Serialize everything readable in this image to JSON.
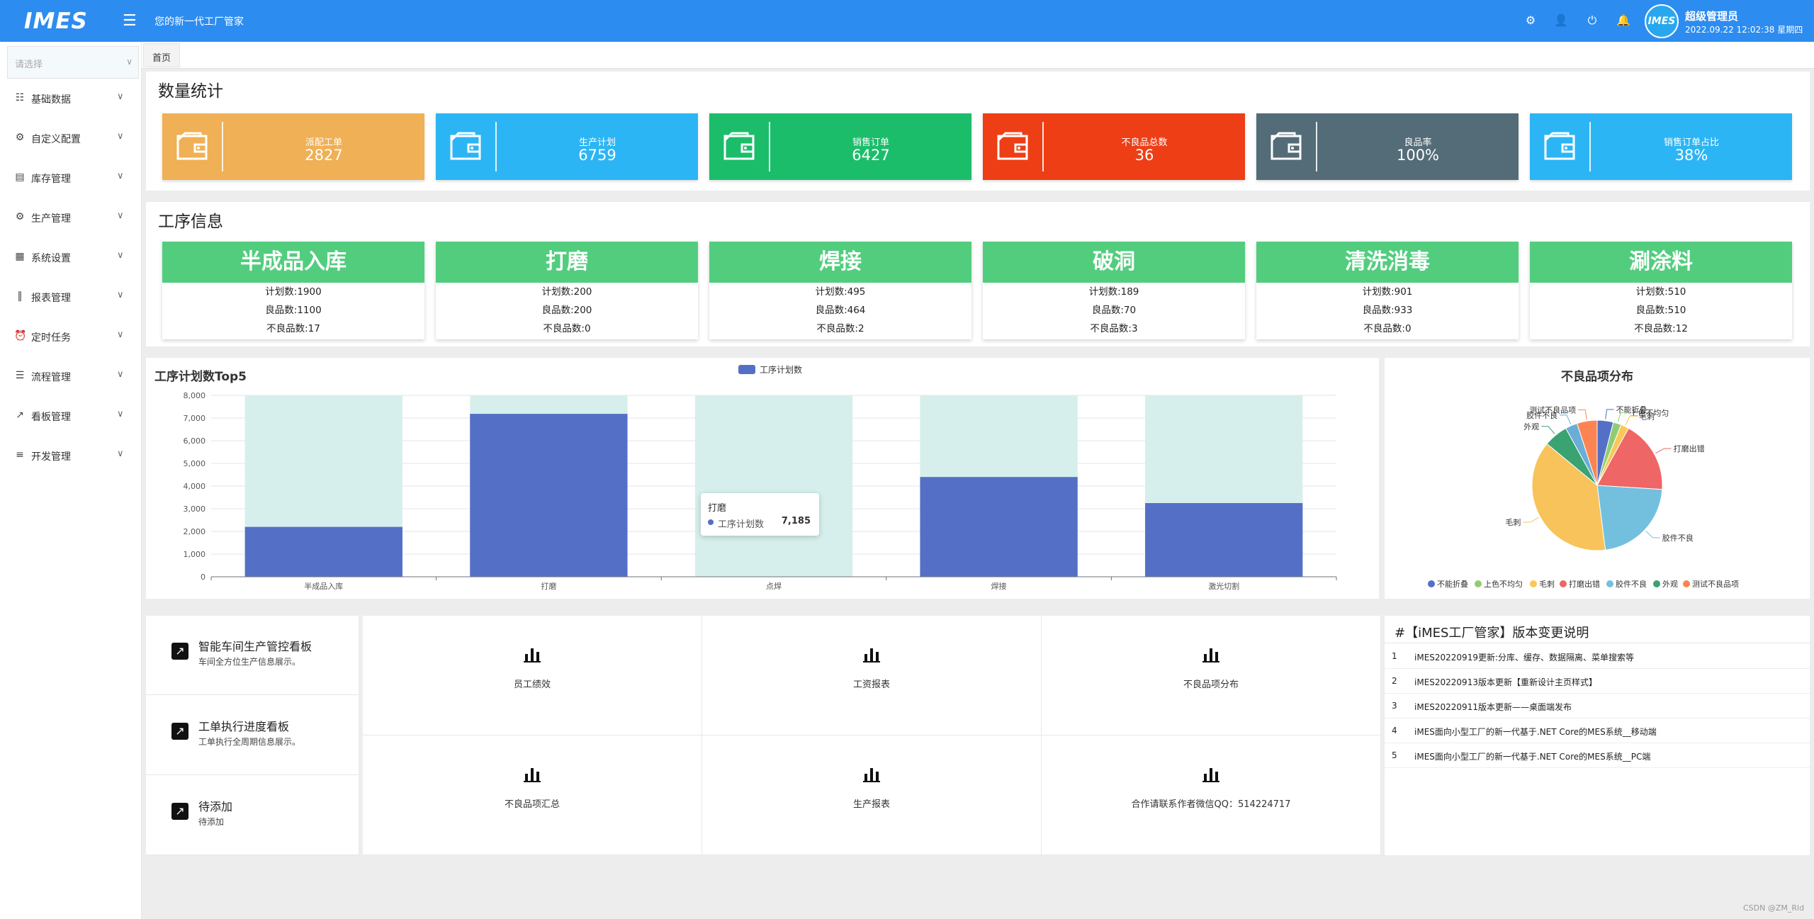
{
  "header": {
    "logo": "IMES",
    "tagline": "您的新一代工厂管家",
    "user_name": "超级管理员",
    "datetime": "2022.09.22 12:02:38 星期四",
    "avatar_text": "IMES",
    "bg_color": "#2d8cf0"
  },
  "sidebar": {
    "select_placeholder": "请选择",
    "items": [
      {
        "label": "基础数据",
        "icon": "document-icon"
      },
      {
        "label": "自定义配置",
        "icon": "settings-icon"
      },
      {
        "label": "库存管理",
        "icon": "inventory-icon"
      },
      {
        "label": "生产管理",
        "icon": "gear-icon"
      },
      {
        "label": "系统设置",
        "icon": "grid-icon"
      },
      {
        "label": "报表管理",
        "icon": "bar-chart-icon"
      },
      {
        "label": "定时任务",
        "icon": "alarm-icon"
      },
      {
        "label": "流程管理",
        "icon": "process-icon"
      },
      {
        "label": "看板管理",
        "icon": "trend-icon"
      },
      {
        "label": "开发管理",
        "icon": "sliders-icon"
      }
    ]
  },
  "breadcrumb": {
    "home": "首页"
  },
  "stats": {
    "title": "数量统计",
    "cards": [
      {
        "label": "派配工单",
        "value": "2827",
        "color": "#f0b055"
      },
      {
        "label": "生产计划",
        "value": "6759",
        "color": "#2cb5f4"
      },
      {
        "label": "销售订单",
        "value": "6427",
        "color": "#1cbd6a"
      },
      {
        "label": "不良品总数",
        "value": "36",
        "color": "#ee3e16"
      },
      {
        "label": "良品率",
        "value": "100%",
        "color": "#546c78"
      },
      {
        "label": "销售订单占比",
        "value": "38%",
        "color": "#2cb5f4"
      }
    ]
  },
  "process": {
    "title": "工序信息",
    "cards": [
      {
        "name": "半成品入库",
        "plan": "计划数:1900",
        "good": "良品数:1100",
        "bad": "不良品数:17"
      },
      {
        "name": "打磨",
        "plan": "计划数:200",
        "good": "良品数:200",
        "bad": "不良品数:0"
      },
      {
        "name": "焊接",
        "plan": "计划数:495",
        "good": "良品数:464",
        "bad": "不良品数:2"
      },
      {
        "name": "破洞",
        "plan": "计划数:189",
        "good": "良品数:70",
        "bad": "不良品数:3"
      },
      {
        "name": "清洗消毒",
        "plan": "计划数:901",
        "good": "良品数:933",
        "bad": "不良品数:0"
      },
      {
        "name": "涮涂料",
        "plan": "计划数:510",
        "good": "良品数:510",
        "bad": "不良品数:12"
      }
    ]
  },
  "bar_panel": {
    "title": "工序计划数Top5",
    "tooltip": {
      "category": "打磨",
      "series": "工序计划数",
      "value": "7,185"
    }
  },
  "pie_panel": {
    "title": "不良品项分布"
  },
  "chart_data": [
    {
      "type": "bar",
      "title": "工序计划数Top5",
      "categories": [
        "半成品入库",
        "打磨",
        "点焊",
        "焊接",
        "激光切割"
      ],
      "series": [
        {
          "name": "工序计划数",
          "values": [
            2200,
            7185,
            0,
            4400,
            3250
          ],
          "color": "#5470c6"
        }
      ],
      "ylim": [
        0,
        8000
      ],
      "yticks": [
        "0",
        "1,000",
        "2,000",
        "3,000",
        "4,000",
        "5,000",
        "6,000",
        "7,000",
        "8,000"
      ],
      "grid": true,
      "legend": "top-center"
    },
    {
      "type": "pie",
      "title": "不良品项分布",
      "slices": [
        {
          "label": "不能折叠",
          "value": 4,
          "color": "#5470c6"
        },
        {
          "label": "上色不均匀",
          "value": 2,
          "color": "#91cc75"
        },
        {
          "label": "毛刺",
          "value": 2,
          "color": "#fac858"
        },
        {
          "label": "打磨出错",
          "value": 18,
          "color": "#ee6666"
        },
        {
          "label": "胶件不良",
          "value": 22,
          "color": "#73c0de"
        },
        {
          "label": "毛刺",
          "value": 38,
          "color": "#f7c35a"
        },
        {
          "label": "外观",
          "value": 6,
          "color": "#3ba272"
        },
        {
          "label": "胶件不良",
          "value": 3,
          "color": "#6aaed6"
        },
        {
          "label": "测试不良品项",
          "value": 5,
          "color": "#fc8452"
        }
      ],
      "legend_items": [
        {
          "label": "不能折叠",
          "color": "#5470c6"
        },
        {
          "label": "上色不均匀",
          "color": "#91cc75"
        },
        {
          "label": "毛刺",
          "color": "#fac858"
        },
        {
          "label": "打磨出错",
          "color": "#ee6666"
        },
        {
          "label": "胶件不良",
          "color": "#73c0de"
        },
        {
          "label": "外观",
          "color": "#3ba272"
        },
        {
          "label": "测试不良品项",
          "color": "#fc8452"
        }
      ],
      "legend": "bottom"
    }
  ],
  "kanban": [
    {
      "title": "智能车间生产管控看板",
      "sub": "车间全方位生产信息展示。"
    },
    {
      "title": "工单执行进度看板",
      "sub": "工单执行全周期信息展示。"
    },
    {
      "title": "待添加",
      "sub": "待添加"
    }
  ],
  "reports": [
    "员工绩效",
    "工资报表",
    "不良品项分布",
    "不良品项汇总",
    "生产报表",
    "合作请联系作者微信QQ：514224717"
  ],
  "changelog": {
    "title": "#【iMES工厂管家】版本变更说明",
    "rows": [
      {
        "n": "1",
        "t": "iMES20220919更新:分库、缓存、数据隔离、菜单搜索等"
      },
      {
        "n": "2",
        "t": "iMES20220913版本更新【重新设计主页样式】"
      },
      {
        "n": "3",
        "t": "iMES20220911版本更新——桌面端发布"
      },
      {
        "n": "4",
        "t": "iMES面向小型工厂的新一代基于.NET Core的MES系统__移动端"
      },
      {
        "n": "5",
        "t": "iMES面向小型工厂的新一代基于.NET Core的MES系统__PC端"
      }
    ]
  },
  "watermark": "CSDN @ZM_Rld"
}
